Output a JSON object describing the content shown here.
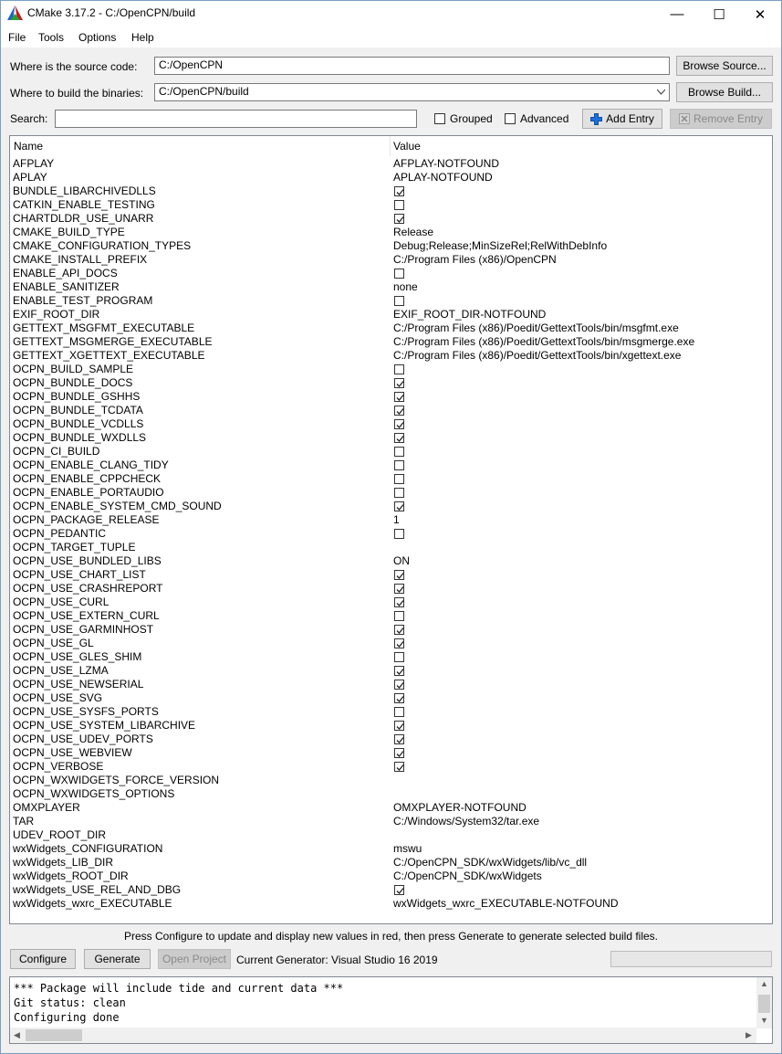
{
  "window": {
    "title": "CMake 3.17.2 - C:/OpenCPN/build",
    "minimize": "—",
    "maximize": "☐",
    "close": "✕"
  },
  "menu": [
    "File",
    "Tools",
    "Options",
    "Help"
  ],
  "source": {
    "label": "Where is the source code:",
    "value": "C:/OpenCPN",
    "browse": "Browse Source..."
  },
  "build": {
    "label": "Where to build the binaries:",
    "value": "C:/OpenCPN/build",
    "browse": "Browse Build..."
  },
  "search": {
    "label": "Search:",
    "value": "",
    "grouped": "Grouped",
    "advanced": "Advanced",
    "add_entry": "Add Entry",
    "remove_entry": "Remove Entry"
  },
  "table": {
    "headers": [
      "Name",
      "Value"
    ],
    "rows": [
      {
        "name": "AFPLAY",
        "type": "text",
        "value": "AFPLAY-NOTFOUND"
      },
      {
        "name": "APLAY",
        "type": "text",
        "value": "APLAY-NOTFOUND"
      },
      {
        "name": "BUNDLE_LIBARCHIVEDLLS",
        "type": "bool",
        "checked": true
      },
      {
        "name": "CATKIN_ENABLE_TESTING",
        "type": "bool",
        "checked": false
      },
      {
        "name": "CHARTDLDR_USE_UNARR",
        "type": "bool",
        "checked": true
      },
      {
        "name": "CMAKE_BUILD_TYPE",
        "type": "text",
        "value": "Release"
      },
      {
        "name": "CMAKE_CONFIGURATION_TYPES",
        "type": "text",
        "value": "Debug;Release;MinSizeRel;RelWithDebInfo"
      },
      {
        "name": "CMAKE_INSTALL_PREFIX",
        "type": "text",
        "value": "C:/Program Files (x86)/OpenCPN"
      },
      {
        "name": "ENABLE_API_DOCS",
        "type": "bool",
        "checked": false
      },
      {
        "name": "ENABLE_SANITIZER",
        "type": "text",
        "value": "none"
      },
      {
        "name": "ENABLE_TEST_PROGRAM",
        "type": "bool",
        "checked": false
      },
      {
        "name": "EXIF_ROOT_DIR",
        "type": "text",
        "value": "EXIF_ROOT_DIR-NOTFOUND"
      },
      {
        "name": "GETTEXT_MSGFMT_EXECUTABLE",
        "type": "text",
        "value": "C:/Program Files (x86)/Poedit/GettextTools/bin/msgfmt.exe"
      },
      {
        "name": "GETTEXT_MSGMERGE_EXECUTABLE",
        "type": "text",
        "value": "C:/Program Files (x86)/Poedit/GettextTools/bin/msgmerge.exe"
      },
      {
        "name": "GETTEXT_XGETTEXT_EXECUTABLE",
        "type": "text",
        "value": "C:/Program Files (x86)/Poedit/GettextTools/bin/xgettext.exe"
      },
      {
        "name": "OCPN_BUILD_SAMPLE",
        "type": "bool",
        "checked": false
      },
      {
        "name": "OCPN_BUNDLE_DOCS",
        "type": "bool",
        "checked": true
      },
      {
        "name": "OCPN_BUNDLE_GSHHS",
        "type": "bool",
        "checked": true
      },
      {
        "name": "OCPN_BUNDLE_TCDATA",
        "type": "bool",
        "checked": true
      },
      {
        "name": "OCPN_BUNDLE_VCDLLS",
        "type": "bool",
        "checked": true
      },
      {
        "name": "OCPN_BUNDLE_WXDLLS",
        "type": "bool",
        "checked": true
      },
      {
        "name": "OCPN_CI_BUILD",
        "type": "bool",
        "checked": false
      },
      {
        "name": "OCPN_ENABLE_CLANG_TIDY",
        "type": "bool",
        "checked": false
      },
      {
        "name": "OCPN_ENABLE_CPPCHECK",
        "type": "bool",
        "checked": false
      },
      {
        "name": "OCPN_ENABLE_PORTAUDIO",
        "type": "bool",
        "checked": false
      },
      {
        "name": "OCPN_ENABLE_SYSTEM_CMD_SOUND",
        "type": "bool",
        "checked": true
      },
      {
        "name": "OCPN_PACKAGE_RELEASE",
        "type": "text",
        "value": "1"
      },
      {
        "name": "OCPN_PEDANTIC",
        "type": "bool",
        "checked": false
      },
      {
        "name": "OCPN_TARGET_TUPLE",
        "type": "text",
        "value": ""
      },
      {
        "name": "OCPN_USE_BUNDLED_LIBS",
        "type": "text",
        "value": "ON"
      },
      {
        "name": "OCPN_USE_CHART_LIST",
        "type": "bool",
        "checked": true
      },
      {
        "name": "OCPN_USE_CRASHREPORT",
        "type": "bool",
        "checked": true
      },
      {
        "name": "OCPN_USE_CURL",
        "type": "bool",
        "checked": true
      },
      {
        "name": "OCPN_USE_EXTERN_CURL",
        "type": "bool",
        "checked": false
      },
      {
        "name": "OCPN_USE_GARMINHOST",
        "type": "bool",
        "checked": true
      },
      {
        "name": "OCPN_USE_GL",
        "type": "bool",
        "checked": true
      },
      {
        "name": "OCPN_USE_GLES_SHIM",
        "type": "bool",
        "checked": false
      },
      {
        "name": "OCPN_USE_LZMA",
        "type": "bool",
        "checked": true
      },
      {
        "name": "OCPN_USE_NEWSERIAL",
        "type": "bool",
        "checked": true
      },
      {
        "name": "OCPN_USE_SVG",
        "type": "bool",
        "checked": true
      },
      {
        "name": "OCPN_USE_SYSFS_PORTS",
        "type": "bool",
        "checked": false
      },
      {
        "name": "OCPN_USE_SYSTEM_LIBARCHIVE",
        "type": "bool",
        "checked": true
      },
      {
        "name": "OCPN_USE_UDEV_PORTS",
        "type": "bool",
        "checked": true
      },
      {
        "name": "OCPN_USE_WEBVIEW",
        "type": "bool",
        "checked": true
      },
      {
        "name": "OCPN_VERBOSE",
        "type": "bool",
        "checked": true
      },
      {
        "name": "OCPN_WXWIDGETS_FORCE_VERSION",
        "type": "text",
        "value": ""
      },
      {
        "name": "OCPN_WXWIDGETS_OPTIONS",
        "type": "text",
        "value": ""
      },
      {
        "name": "OMXPLAYER",
        "type": "text",
        "value": "OMXPLAYER-NOTFOUND"
      },
      {
        "name": "TAR",
        "type": "text",
        "value": "C:/Windows/System32/tar.exe"
      },
      {
        "name": "UDEV_ROOT_DIR",
        "type": "text",
        "value": ""
      },
      {
        "name": "wxWidgets_CONFIGURATION",
        "type": "text",
        "value": "mswu"
      },
      {
        "name": "wxWidgets_LIB_DIR",
        "type": "text",
        "value": "C:/OpenCPN_SDK/wxWidgets/lib/vc_dll"
      },
      {
        "name": "wxWidgets_ROOT_DIR",
        "type": "text",
        "value": "C:/OpenCPN_SDK/wxWidgets"
      },
      {
        "name": "wxWidgets_USE_REL_AND_DBG",
        "type": "bool",
        "checked": true
      },
      {
        "name": "wxWidgets_wxrc_EXECUTABLE",
        "type": "text",
        "value": "wxWidgets_wxrc_EXECUTABLE-NOTFOUND"
      }
    ]
  },
  "hint": "Press Configure to update and display new values in red, then press Generate to generate selected build files.",
  "actions": {
    "configure": "Configure",
    "generate": "Generate",
    "open_project": "Open Project",
    "generator": "Current Generator: Visual Studio 16 2019"
  },
  "log": [
    "*** Package will include tide and current data ***",
    "Git status: clean",
    "Configuring done"
  ],
  "colors": {
    "window_bg": "#f0f0f0",
    "add_icon": "#1e6fd9",
    "remove_icon": "#a0a0a0"
  }
}
